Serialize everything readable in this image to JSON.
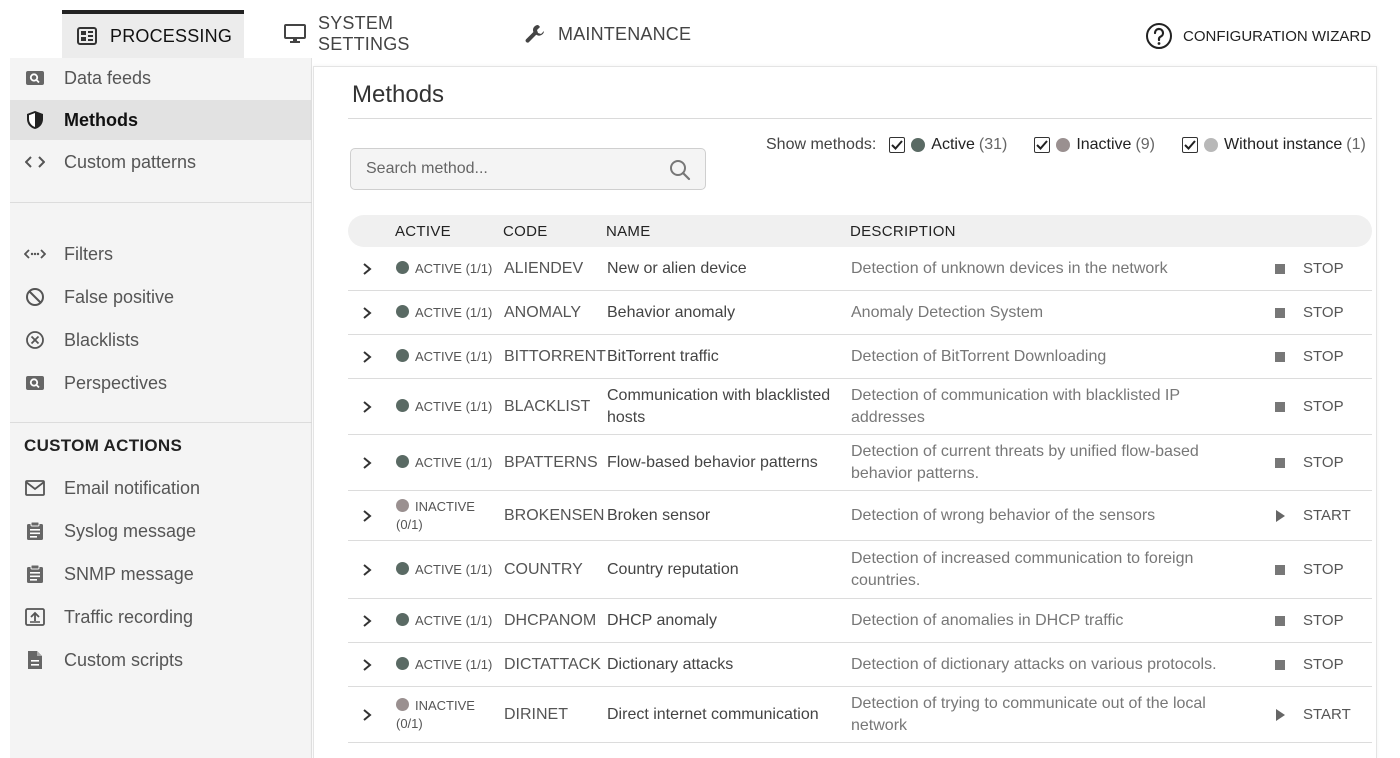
{
  "tabs": {
    "processing": "PROCESSING",
    "system_settings": "SYSTEM SETTINGS",
    "maintenance": "MAINTENANCE",
    "configuration_wizard": "CONFIGURATION WIZARD"
  },
  "sidebar": {
    "data_feeds": "Data feeds",
    "methods": "Methods",
    "custom_patterns": "Custom patterns",
    "filters": "Filters",
    "false_positive": "False positive",
    "blacklists": "Blacklists",
    "perspectives": "Perspectives",
    "custom_actions_heading": "CUSTOM ACTIONS",
    "email_notification": "Email notification",
    "syslog_message": "Syslog message",
    "snmp_message": "SNMP message",
    "traffic_recording": "Traffic recording",
    "custom_scripts": "Custom scripts"
  },
  "main": {
    "title": "Methods",
    "search_placeholder": "Search method...",
    "show_methods_label": "Show methods:",
    "filters": {
      "active_label": "Active",
      "active_count": "(31)",
      "inactive_label": "Inactive",
      "inactive_count": "(9)",
      "without_label": "Without instance",
      "without_count": "(1)"
    },
    "columns": {
      "active": "ACTIVE",
      "code": "CODE",
      "name": "NAME",
      "description": "DESCRIPTION"
    },
    "rows": [
      {
        "status": "ACTIVE (1/1)",
        "code": "ALIENDEV",
        "name": "New or alien device",
        "description": "Detection of unknown devices in the network",
        "action": "STOP"
      },
      {
        "status": "ACTIVE (1/1)",
        "code": "ANOMALY",
        "name": "Behavior anomaly",
        "description": "Anomaly Detection System",
        "action": "STOP"
      },
      {
        "status": "ACTIVE (1/1)",
        "code": "BITTORRENT",
        "name": "BitTorrent traffic",
        "description": "Detection of BitTorrent Downloading",
        "action": "STOP"
      },
      {
        "status": "ACTIVE (1/1)",
        "code": "BLACKLIST",
        "name": "Communication with blacklisted hosts",
        "description": "Detection of communication with blacklisted IP addresses",
        "action": "STOP"
      },
      {
        "status": "ACTIVE (1/1)",
        "code": "BPATTERNS",
        "name": "Flow-based behavior patterns",
        "description": "Detection of current threats by unified flow-based behavior patterns.",
        "action": "STOP"
      },
      {
        "status": "INACTIVE (0/1)",
        "code": "BROKENSEN",
        "name": "Broken sensor",
        "description": "Detection of wrong behavior of the sensors",
        "action": "START"
      },
      {
        "status": "ACTIVE (1/1)",
        "code": "COUNTRY",
        "name": "Country reputation",
        "description": "Detection of increased communication to foreign countries.",
        "action": "STOP"
      },
      {
        "status": "ACTIVE (1/1)",
        "code": "DHCPANOM",
        "name": "DHCP anomaly",
        "description": "Detection of anomalies in DHCP traffic",
        "action": "STOP"
      },
      {
        "status": "ACTIVE (1/1)",
        "code": "DICTATTACK",
        "name": "Dictionary attacks",
        "description": "Detection of dictionary attacks on various protocols.",
        "action": "STOP"
      },
      {
        "status": "INACTIVE (0/1)",
        "code": "DIRINET",
        "name": "Direct internet communication",
        "description": "Detection of trying to communicate out of the local network",
        "action": "START"
      }
    ]
  },
  "colors": {
    "active_dot": "#5a6a64",
    "inactive_dot": "#9a9090",
    "without_dot": "#b8b8b8",
    "tab_active_bg": "#ececec",
    "sidebar_bg": "#f4f4f4"
  },
  "icons": {
    "processing": "dashboard-icon",
    "system_settings": "monitor-icon",
    "maintenance": "wrench-icon",
    "wizard": "question-circle-icon",
    "search": "magnifier-icon"
  }
}
